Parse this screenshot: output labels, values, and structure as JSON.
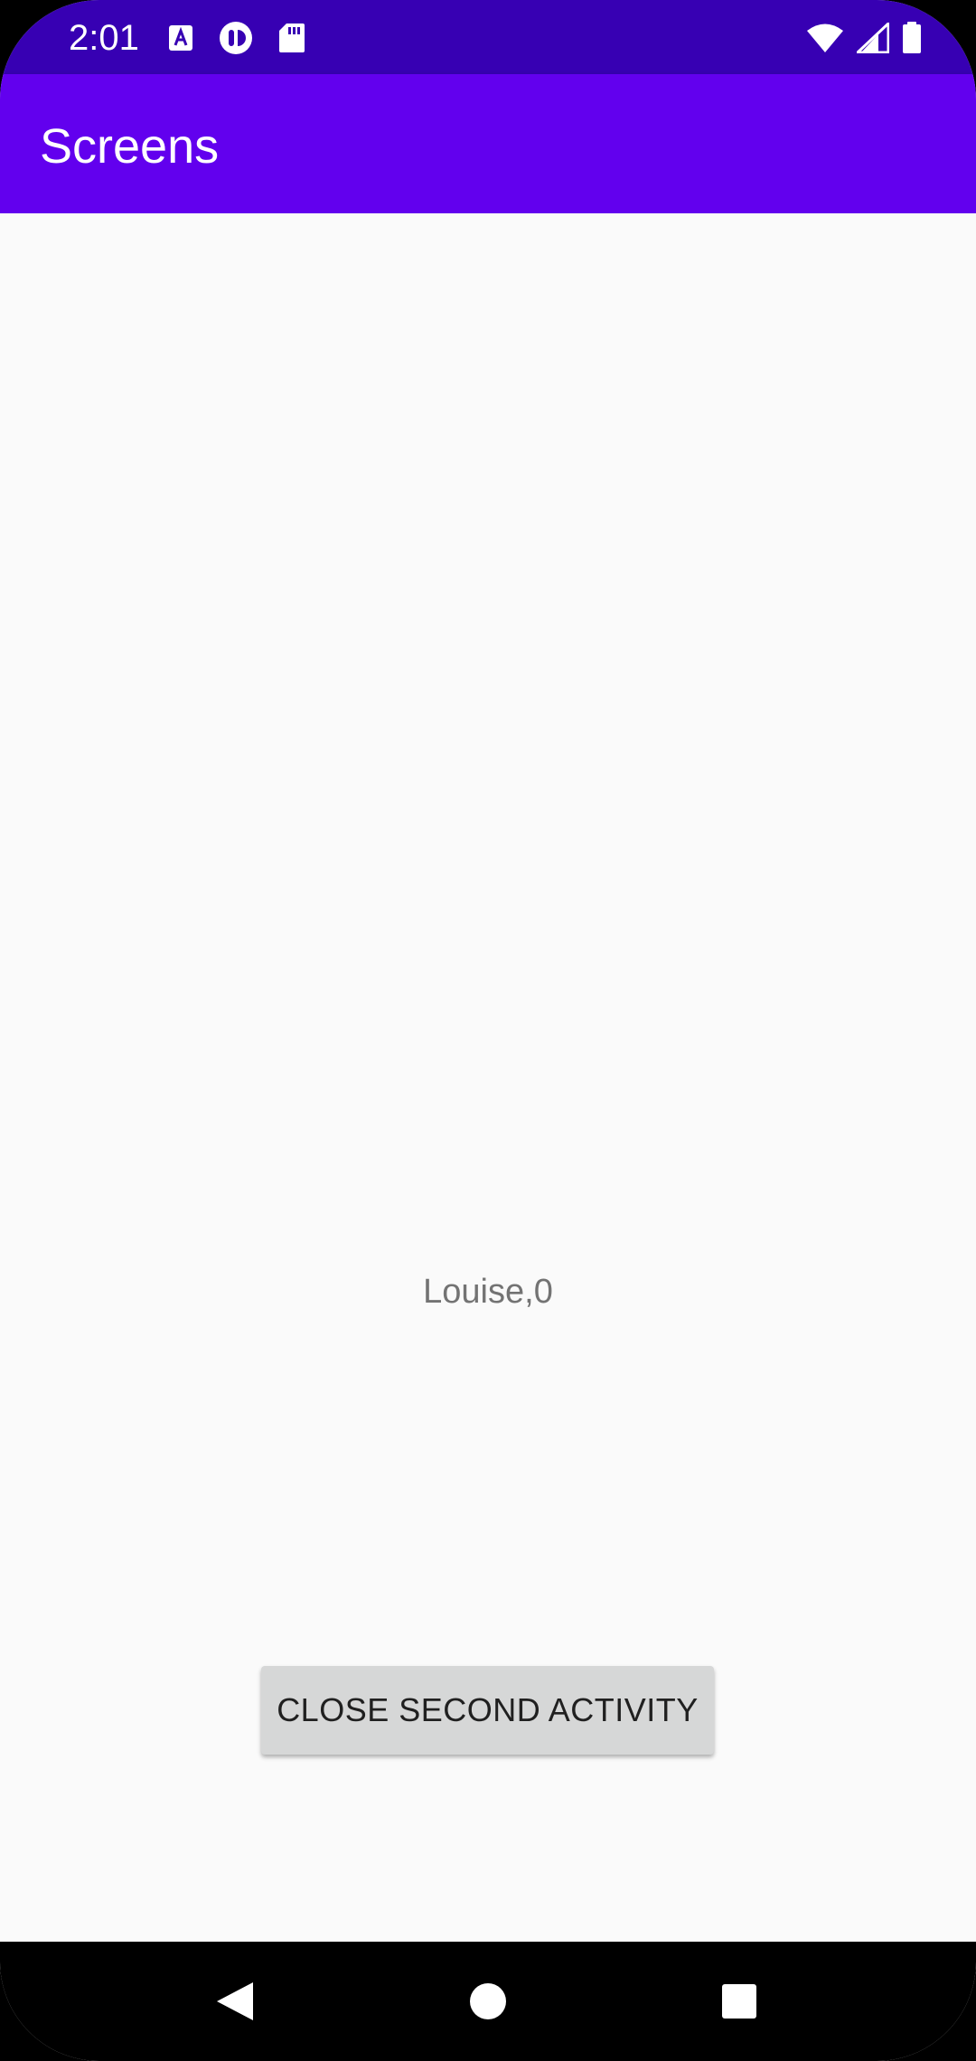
{
  "status_bar": {
    "time": "2:01",
    "left_icons": [
      "keyboard-a-icon",
      "app-badge-icon",
      "sd-card-icon"
    ],
    "right_icons": [
      "wifi-icon",
      "signal-icon",
      "battery-icon"
    ],
    "background": "#3700b3"
  },
  "app_bar": {
    "title": "Screens",
    "background": "#6200ee"
  },
  "main": {
    "value_text": "Louise,0",
    "close_button_label": "CLOSE SECOND ACTIVITY"
  },
  "nav_bar": {
    "buttons": [
      "back-icon",
      "home-icon",
      "recents-icon"
    ]
  }
}
